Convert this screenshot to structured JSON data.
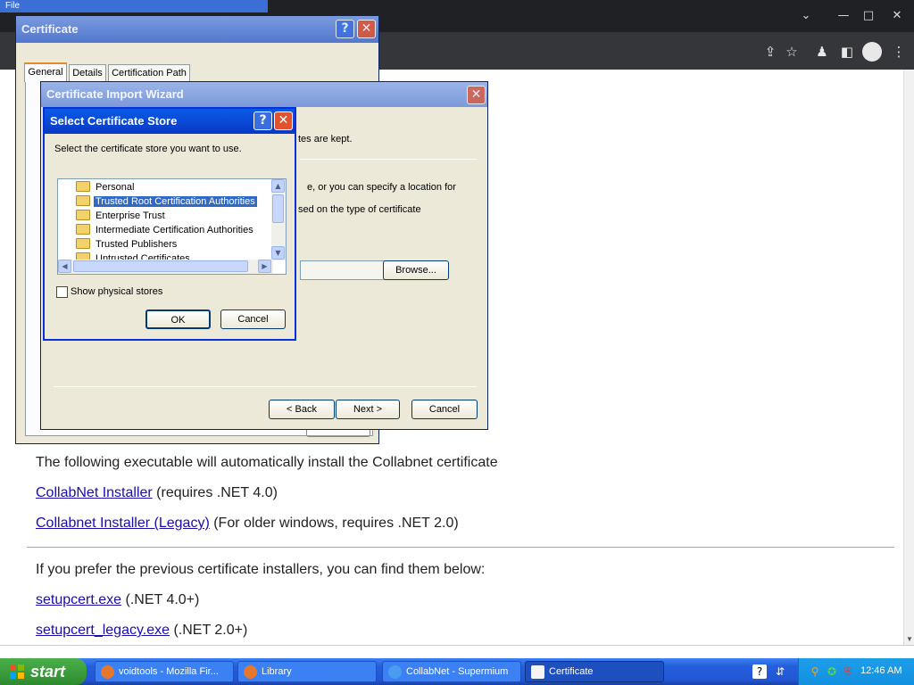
{
  "browser": {
    "menu_hint": "File",
    "controls": {
      "chevron": "⌄",
      "minimize": "—",
      "maximize": "□",
      "close": "✕"
    },
    "toolbar_icons": [
      "share-icon",
      "star-icon",
      "extensions-icon",
      "sidebar-icon",
      "profile-icon",
      "menu-icon"
    ],
    "content": {
      "intro": "The following executable will automatically install the Collabnet certificate",
      "links": [
        {
          "link": "CollabNet Installer",
          "note": " (requires .NET 4.0)"
        },
        {
          "link": "Collabnet Installer (Legacy)",
          "note": " (For older windows, requires .NET 2.0)"
        }
      ],
      "prev_intro": "If you prefer the previous certificate installers, you can find them below:",
      "prev_links": [
        {
          "link": "setupcert.exe",
          "note": " (.NET 4.0+)"
        },
        {
          "link": "setupcert_legacy.exe",
          "note": " (.NET 2.0+)"
        }
      ]
    }
  },
  "cert_window": {
    "title": "Certificate",
    "help": "?",
    "close": "✕",
    "tabs": [
      "General",
      "Details",
      "Certification Path"
    ]
  },
  "wizard": {
    "title": "Certificate Import Wizard",
    "close": "✕",
    "text1": "tes are kept.",
    "text2": "e, or you can specify a location for",
    "text3": "sed on the type of certificate",
    "browse": "Browse...",
    "back": "< Back",
    "next": "Next >",
    "cancel": "Cancel"
  },
  "store_dialog": {
    "title": "Select Certificate Store",
    "help": "?",
    "close": "✕",
    "prompt": "Select the certificate store you want to use.",
    "stores": [
      "Personal",
      "Trusted Root Certification Authorities",
      "Enterprise Trust",
      "Intermediate Certification Authorities",
      "Trusted Publishers",
      "Untrusted Certificates"
    ],
    "selected_index": 1,
    "show_physical": "Show physical stores",
    "ok": "OK",
    "cancel": "Cancel"
  },
  "taskbar": {
    "start": "start",
    "items": [
      {
        "label": "voidtools - Mozilla Fir...",
        "color": "#e8772e"
      },
      {
        "label": "Library",
        "color": "#e8772e"
      },
      {
        "label": "CollabNet - Supermium",
        "color": "#4a9cf0"
      },
      {
        "label": "Certificate",
        "color": "#f3f3f3"
      }
    ],
    "clock": "12:46 AM"
  }
}
